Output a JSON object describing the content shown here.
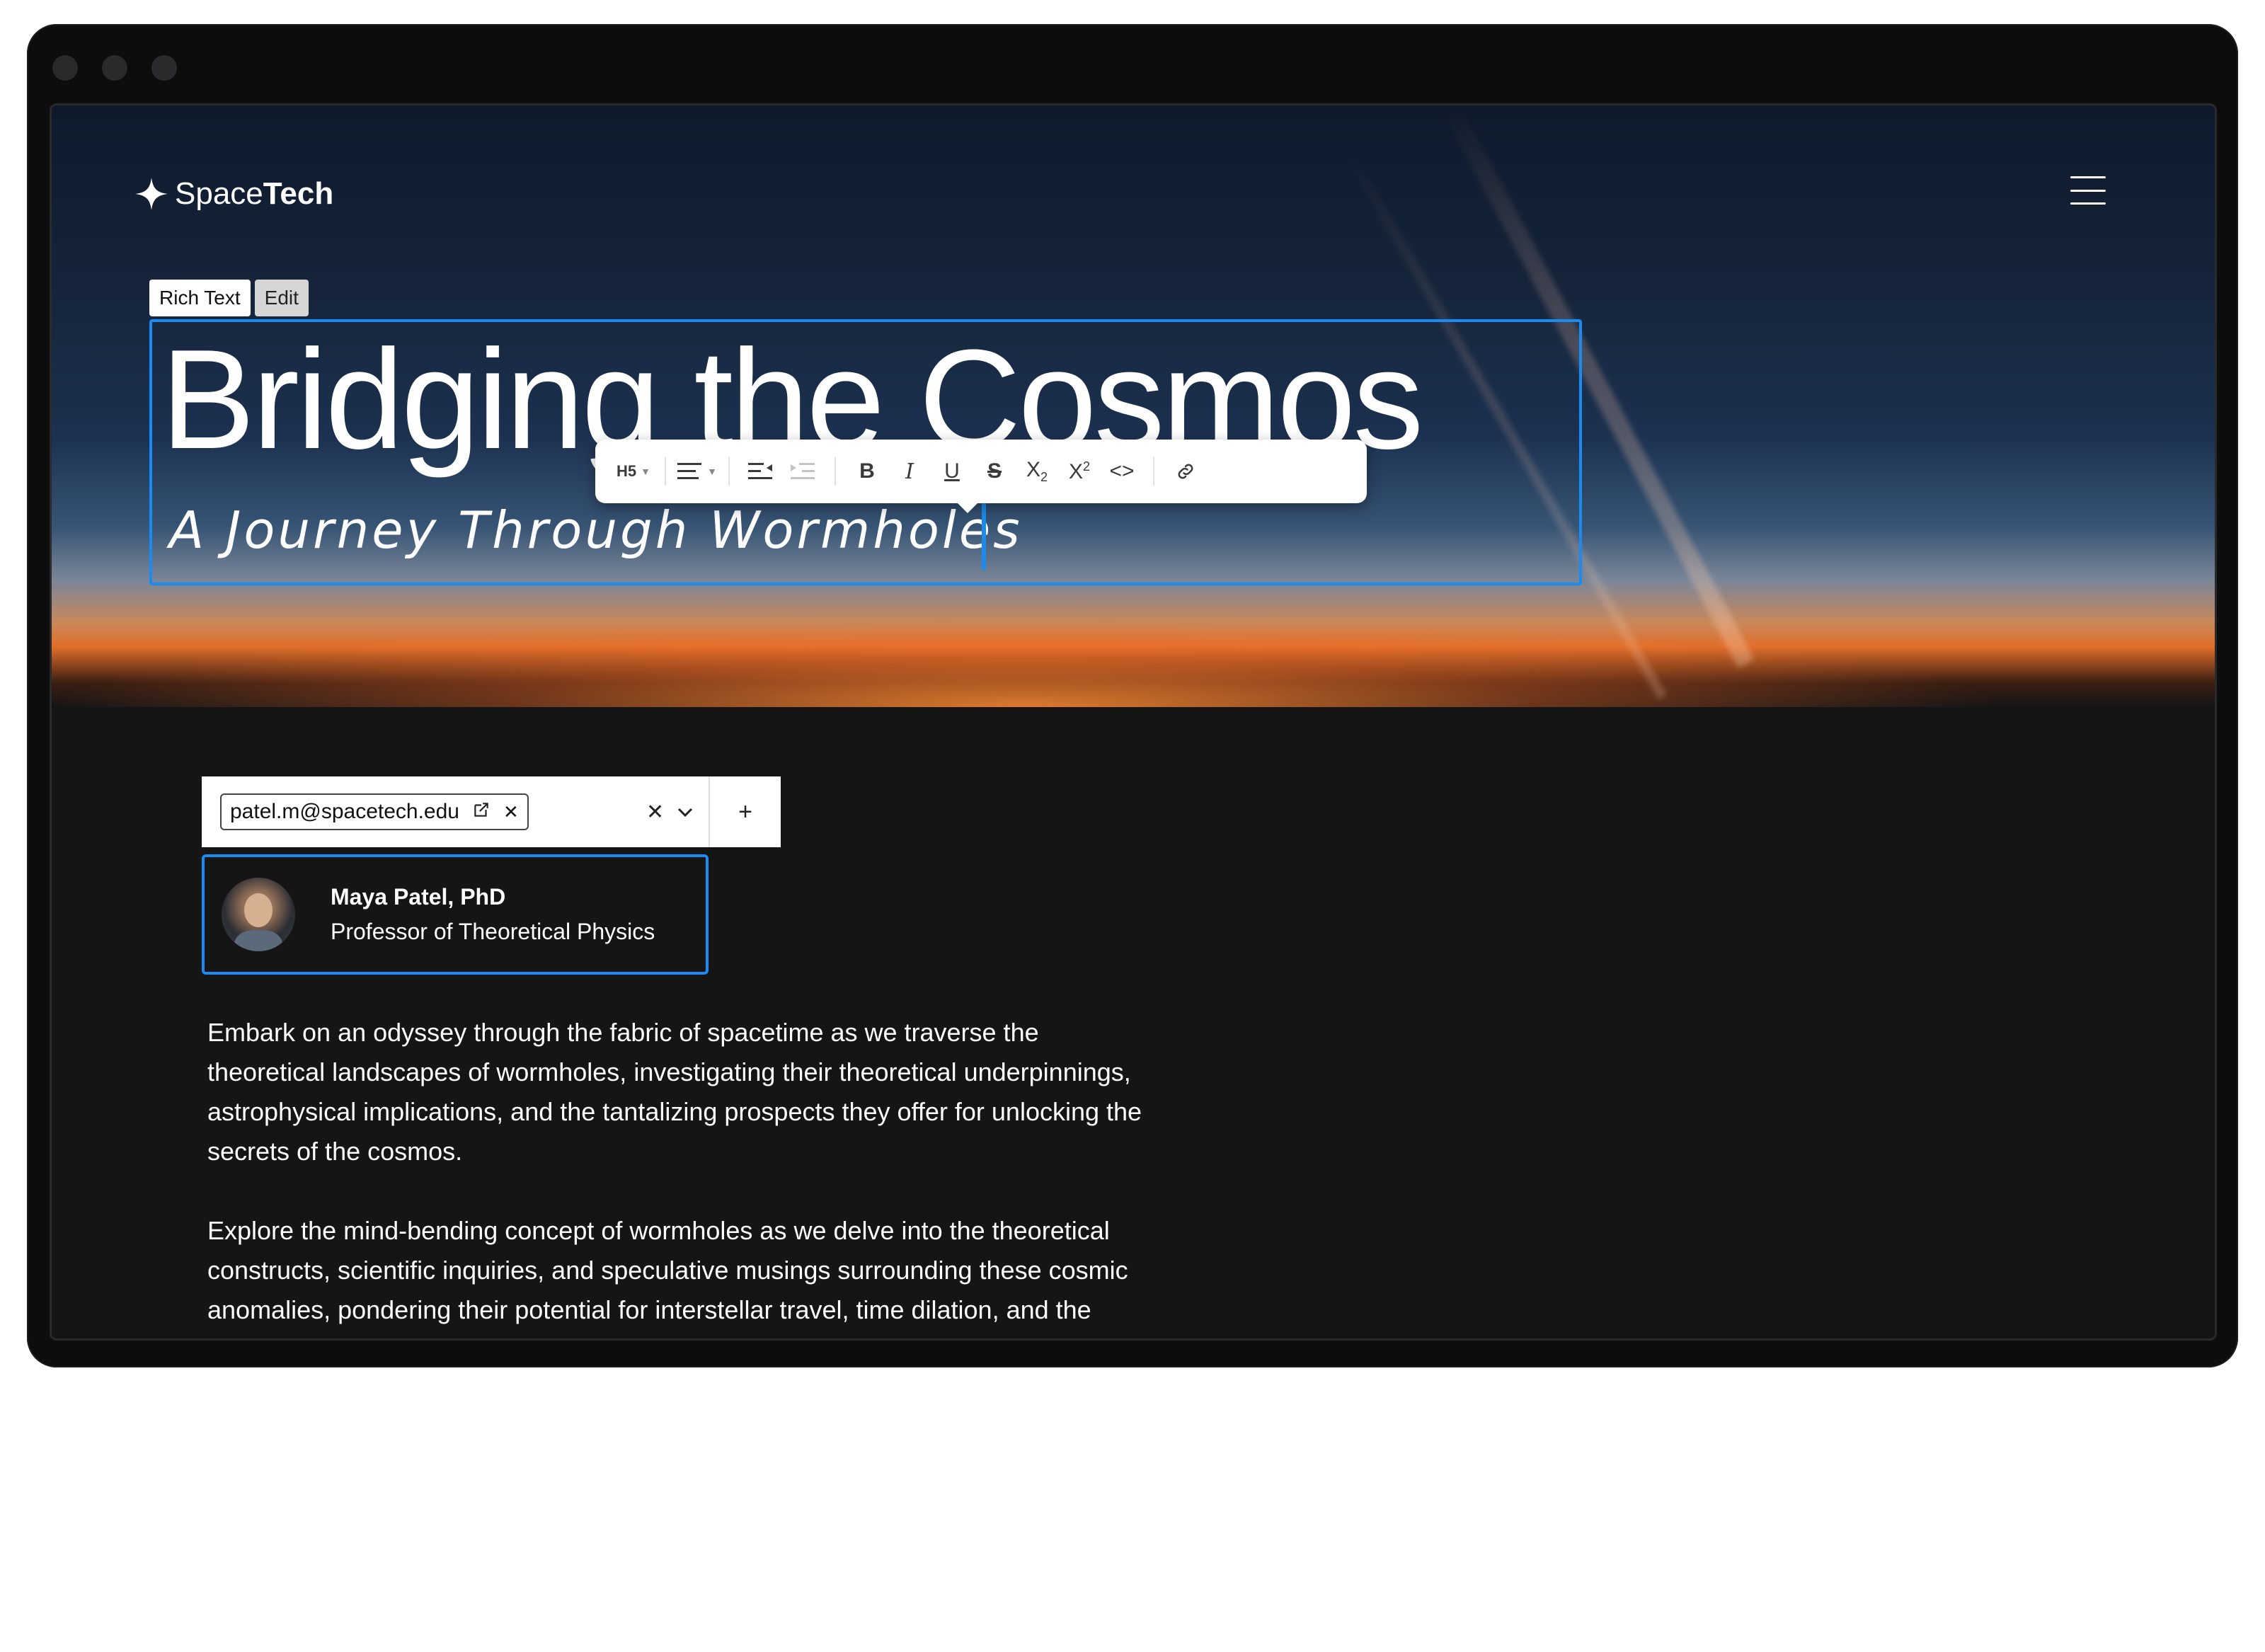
{
  "brand": {
    "name_regular": "Space",
    "name_bold": "Tech"
  },
  "editor": {
    "badge_type": "Rich Text",
    "badge_edit": "Edit",
    "title": "Bridging the Cosmos",
    "subtitle": "A Journey Through Wormholes"
  },
  "toolbar": {
    "heading_level": "H5",
    "bold": "B",
    "italic": "I",
    "underline": "U",
    "strike": "S",
    "subscript_base": "X",
    "subscript_mark": "2",
    "superscript_base": "X",
    "superscript_mark": "2",
    "code": "<>"
  },
  "author_select": {
    "value": "patel.m@spacetech.edu",
    "add_label": "+"
  },
  "author": {
    "name": "Maya Patel, PhD",
    "role": "Professor of Theoretical Physics"
  },
  "body": {
    "paragraph_1": "Embark on an odyssey through the fabric of spacetime as we traverse the theoretical landscapes of wormholes, investigating their theoretical underpinnings, astrophysical implications, and the tantalizing prospects they offer for unlocking the secrets of the cosmos.",
    "paragraph_2": "Explore the mind-bending concept of wormholes as we delve into the theoretical constructs, scientific inquiries, and speculative musings surrounding these cosmic anomalies, pondering their potential for interstellar travel, time dilation, and the unraveling of the mysteries of the universe."
  },
  "colors": {
    "accent": "#1a8bf0",
    "background": "#151516",
    "text": "#ffffff"
  }
}
